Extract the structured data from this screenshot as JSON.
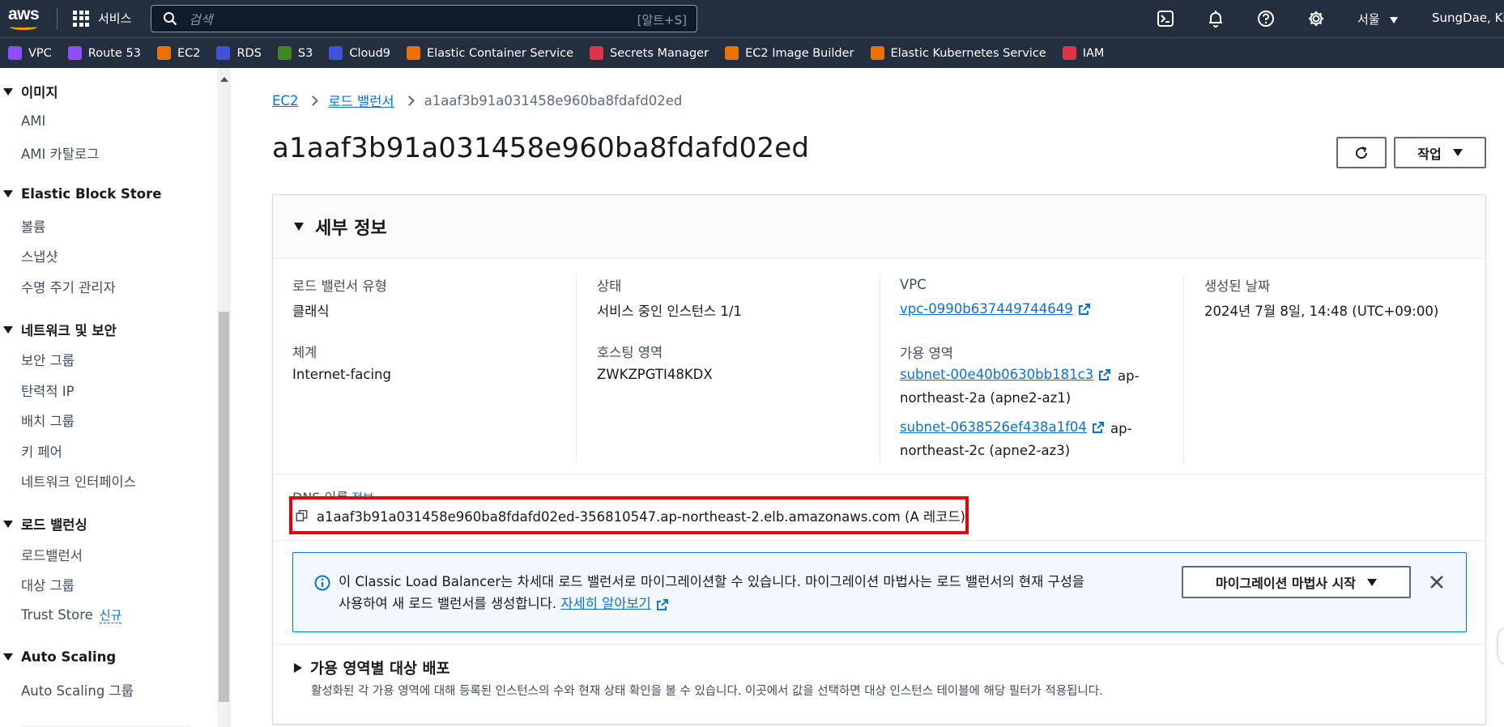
{
  "topnav": {
    "services_label": "서비스",
    "search_placeholder": "검색",
    "search_hint": "[알트+S]",
    "region": "서울",
    "user": "SungDae, Kim"
  },
  "favorites": [
    {
      "label": "VPC",
      "color": "#8c4fff"
    },
    {
      "label": "Route 53",
      "color": "#8c4fff"
    },
    {
      "label": "EC2",
      "color": "#ed7100"
    },
    {
      "label": "RDS",
      "color": "#4053d6"
    },
    {
      "label": "S3",
      "color": "#3f8624"
    },
    {
      "label": "Cloud9",
      "color": "#4053d6"
    },
    {
      "label": "Elastic Container Service",
      "color": "#ed7100"
    },
    {
      "label": "Secrets Manager",
      "color": "#dd344c"
    },
    {
      "label": "EC2 Image Builder",
      "color": "#ed7100"
    },
    {
      "label": "Elastic Kubernetes Service",
      "color": "#ed7100"
    },
    {
      "label": "IAM",
      "color": "#dd344c"
    }
  ],
  "sidebar": {
    "sections": [
      {
        "title": "이미지",
        "items": [
          "AMI",
          "AMI 카탈로그"
        ]
      },
      {
        "title": "Elastic Block Store",
        "items": [
          "볼륨",
          "스냅샷",
          "수명 주기 관리자"
        ]
      },
      {
        "title": "네트워크 및 보안",
        "items": [
          "보안 그룹",
          "탄력적 IP",
          "배치 그룹",
          "키 페어",
          "네트워크 인터페이스"
        ]
      },
      {
        "title": "로드 밸런싱",
        "items": [
          "로드밸런서",
          "대상 그룹",
          "Trust Store"
        ]
      },
      {
        "title": "Auto Scaling",
        "items": [
          "Auto Scaling 그룹"
        ]
      }
    ],
    "new_badge": "신규"
  },
  "breadcrumb": {
    "items": [
      "EC2",
      "로드 밸런서"
    ],
    "current": "a1aaf3b91a031458e960ba8fdafd02ed"
  },
  "page": {
    "title": "a1aaf3b91a031458e960ba8fdafd02ed",
    "actions_label": "작업"
  },
  "details": {
    "title": "세부 정보",
    "lb_type_label": "로드 밸런서 유형",
    "lb_type_value": "클래식",
    "scheme_label": "체계",
    "scheme_value": "Internet-facing",
    "state_label": "상태",
    "state_value": "서비스 중인 인스턴스 1/1",
    "hosted_zone_label": "호스팅 영역",
    "hosted_zone_value": "ZWKZPGTI48KDX",
    "vpc_label": "VPC",
    "vpc_value": "vpc-0990b637449744649",
    "az_label": "가용 영역",
    "subnets": [
      {
        "id": "subnet-00e40b0630bb181c3",
        "zone_a": "ap-",
        "zone_b": "northeast-2a (apne2-az1)"
      },
      {
        "id": "subnet-0638526ef438a1f04",
        "zone_a": "ap-",
        "zone_b": "northeast-2c (apne2-az3)"
      }
    ],
    "created_label": "생성된 날짜",
    "created_value": "2024년 7월 8일, 14:48 (UTC+09:00)",
    "dns_label": "DNS 이름",
    "dns_info": "정보",
    "dns_value": "a1aaf3b91a031458e960ba8fdafd02ed-356810547.ap-northeast-2.elb.amazonaws.com (A 레코드)"
  },
  "migration": {
    "text_line1": "이 Classic Load Balancer는 차세대 로드 밸런서로 마이그레이션할 수 있습니다. 마이그레이션 마법사는 로드 밸런서의 현재 구성을",
    "text_line2": "사용하여 새 로드 밸런서를 생성합니다.",
    "link_label": "자세히 알아보기",
    "button_label": "마이그레이션 마법사 시작"
  },
  "az_distribution": {
    "title": "가용 영역별 대상 배포",
    "description": "활성화된 각 가용 영역에 대해 등록된 인스턴스의 수와 현재 상태 확인을 볼 수 있습니다. 이곳에서 값을 선택하면 대상 인스턴스 테이블에 해당 필터가 적용됩니다."
  }
}
